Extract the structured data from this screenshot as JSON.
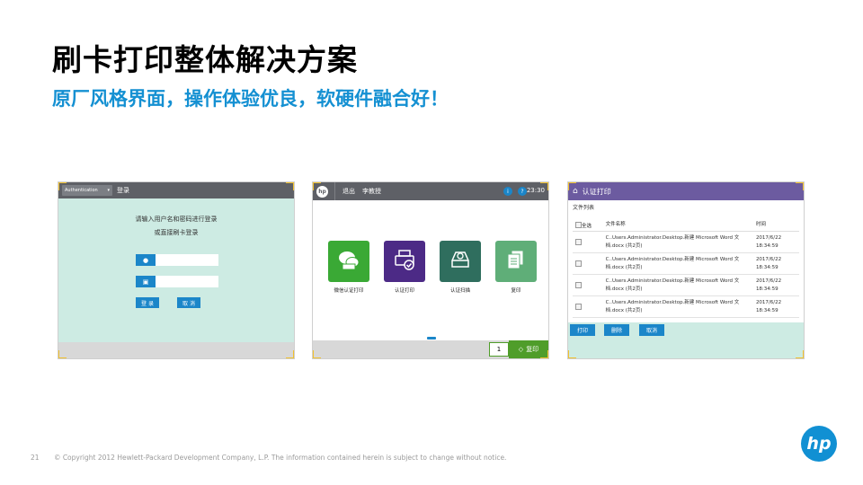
{
  "title": "刷卡打印整体解决方案",
  "subtitle": "原厂风格界面，操作体验优良，软硬件融合好！",
  "panel_login": {
    "auth_select": "Authentication",
    "bar_title": "登录",
    "prompt_line1": "请输入用户名和密码进行登录",
    "prompt_line2": "或直接刷卡登录",
    "username_value": "",
    "password_value": "",
    "login_button": "登 录",
    "cancel_button": "取 消"
  },
  "panel_home": {
    "hp_logo": "hp",
    "logout": "退出",
    "user": "李教授",
    "info_icon": "i",
    "help_icon": "?",
    "time": "23:30",
    "tiles": [
      {
        "label": "微信认证打印",
        "color": "#3aa935",
        "icon": "wechat-print-icon"
      },
      {
        "label": "认证打印",
        "color": "#4c2a86",
        "icon": "print-check-icon"
      },
      {
        "label": "认证扫描",
        "color": "#2f6e5e",
        "icon": "scan-check-icon"
      },
      {
        "label": "复印",
        "color": "#5fae78",
        "icon": "copy-icon"
      }
    ],
    "copies": "1",
    "copy_button": "复印"
  },
  "panel_print": {
    "bar_title": "认证打印",
    "file_list_label": "文件列表",
    "header": {
      "select_all": "全选",
      "name": "文件名称",
      "time": "时间"
    },
    "rows": [
      {
        "name_line1": "C..Users.Administrator.Desktop.新建 Microsoft Word 文",
        "name_line2": "档.docx (共2页)",
        "date": "2017/6/22",
        "clock": "18:34:59"
      },
      {
        "name_line1": "C..Users.Administrator.Desktop.新建 Microsoft Word 文",
        "name_line2": "档.docx (共2页)",
        "date": "2017/6/22",
        "clock": "18:34:59"
      },
      {
        "name_line1": "C..Users.Administrator.Desktop.新建 Microsoft Word 文",
        "name_line2": "档.docx (共2页)",
        "date": "2017/6/22",
        "clock": "18:34:59"
      },
      {
        "name_line1": "C..Users.Administrator.Desktop.新建 Microsoft Word 文",
        "name_line2": "档.docx (共2页)",
        "date": "2017/6/22",
        "clock": "18:34:59"
      }
    ],
    "print_button": "打印",
    "delete_button": "删除",
    "cancel_button": "取消"
  },
  "footer": {
    "page_number": "21",
    "copyright": "© Copyright 2012 Hewlett-Packard Development Company, L.P.  The information contained herein is subject to change without notice."
  },
  "logo": "hp"
}
